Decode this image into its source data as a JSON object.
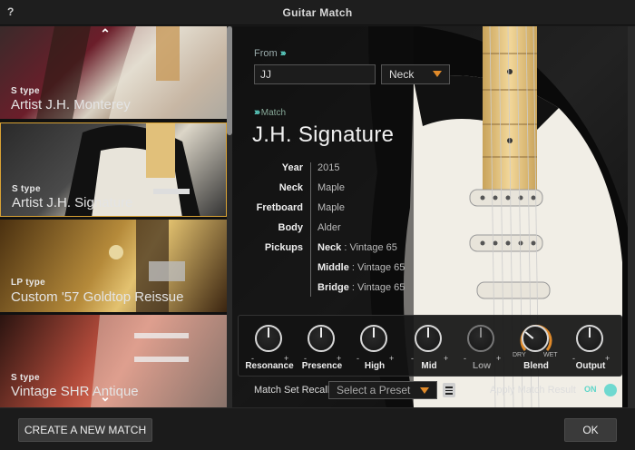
{
  "window": {
    "title": "Guitar Match",
    "help": "?"
  },
  "sidebar": {
    "items": [
      {
        "type": "S type",
        "name": "Artist J.H. Monterey"
      },
      {
        "type": "S type",
        "name": "Artist J.H. Signature"
      },
      {
        "type": "LP type",
        "name": "Custom '57 Goldtop Reissue"
      },
      {
        "type": "S type",
        "name": "Vintage SHR Antique"
      }
    ],
    "selected_index": 1
  },
  "from": {
    "label": "From",
    "input_value": "JJ",
    "position_select": "Neck"
  },
  "match": {
    "label": "Match",
    "title": "J.H. Signature",
    "specs": [
      {
        "key": "Year",
        "value": "2015"
      },
      {
        "key": "Neck",
        "value": "Maple"
      },
      {
        "key": "Fretboard",
        "value": "Maple"
      },
      {
        "key": "Body",
        "value": "Alder"
      },
      {
        "key": "Pickups",
        "pickup": "Neck",
        "value": "Vintage 65"
      },
      {
        "key": "",
        "pickup": "Middle",
        "value": "Vintage 65"
      },
      {
        "key": "",
        "pickup": "Bridge",
        "value": "Vintage 65"
      }
    ]
  },
  "knobs": [
    {
      "label": "Resonance"
    },
    {
      "label": "Presence"
    },
    {
      "label": "High"
    },
    {
      "label": "Mid"
    },
    {
      "label": "Low"
    },
    {
      "label": "Blend",
      "dry": "DRY",
      "wet": "WET"
    },
    {
      "label": "Output"
    }
  ],
  "recall": {
    "label": "Match Set Recall",
    "preset_placeholder": "Select a Preset",
    "apply_label": "Apply Match Result",
    "toggle_state": "ON"
  },
  "footer": {
    "create_label": "CREATE A NEW MATCH",
    "ok_label": "OK"
  },
  "colors": {
    "accent_teal": "#5ed6c9",
    "selection_gold": "#d9a234",
    "dropdown_orange": "#e08a2a",
    "blend_arc": "#e08a2a"
  }
}
